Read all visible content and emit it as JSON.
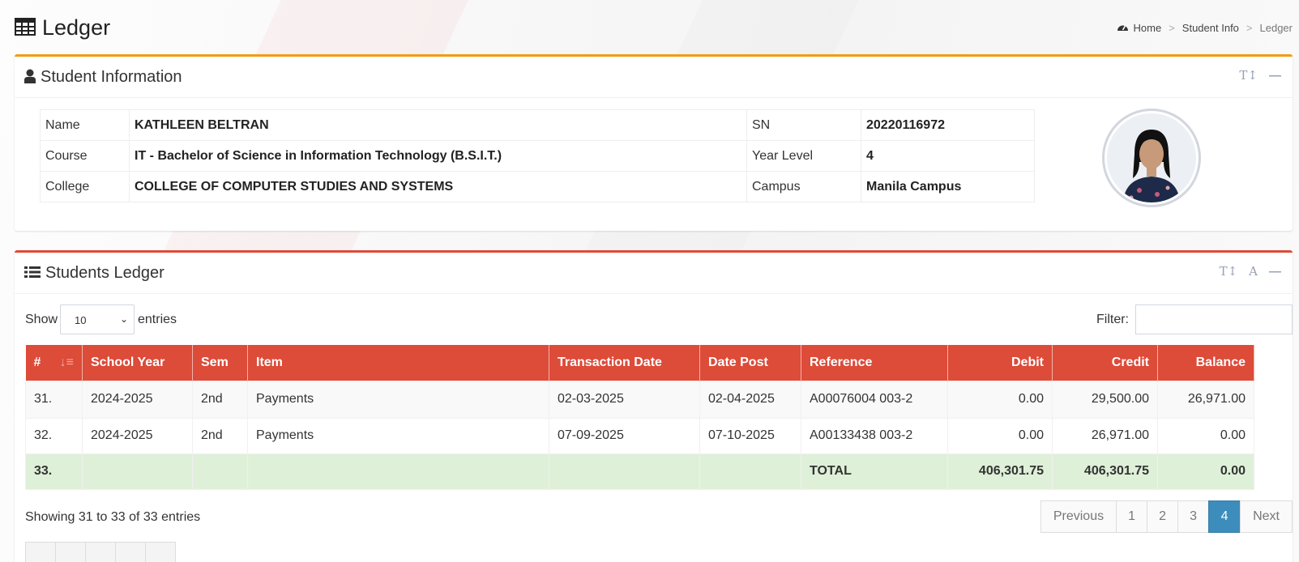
{
  "header": {
    "title": "Ledger",
    "icon": "table-icon"
  },
  "breadcrumb": [
    {
      "label": "Home",
      "icon": "dashboard-icon"
    },
    {
      "label": "Student Info"
    },
    {
      "label": "Ledger"
    }
  ],
  "student_info": {
    "title": "Student Information",
    "rows": [
      {
        "l1": "Name",
        "v1": "KATHLEEN BELTRAN",
        "l2": "SN",
        "v2": "20220116972"
      },
      {
        "l1": "Course",
        "v1": "IT - Bachelor of Science in Information Technology (B.S.I.T.)",
        "l2": "Year Level",
        "v2": "4"
      },
      {
        "l1": "College",
        "v1": "COLLEGE OF COMPUTER STUDIES AND SYSTEMS",
        "l2": "Campus",
        "v2": "Manila Campus"
      }
    ]
  },
  "ledger": {
    "title": "Students Ledger",
    "show_label": "Show",
    "entries_value": "10",
    "entries_label": "entries",
    "filter_label": "Filter:",
    "filter_value": "",
    "columns": [
      "#",
      "School Year",
      "Sem",
      "Item",
      "Transaction Date",
      "Date Post",
      "Reference",
      "Debit",
      "Credit",
      "Balance"
    ],
    "rows": [
      {
        "no": "31.",
        "sy": "2024-2025",
        "sem": "2nd",
        "item": "Payments",
        "tdate": "02-03-2025",
        "dpost": "02-04-2025",
        "ref": "A00076004 003-2",
        "debit": "0.00",
        "credit": "29,500.00",
        "balance": "26,971.00"
      },
      {
        "no": "32.",
        "sy": "2024-2025",
        "sem": "2nd",
        "item": "Payments",
        "tdate": "07-09-2025",
        "dpost": "07-10-2025",
        "ref": "A00133438 003-2",
        "debit": "0.00",
        "credit": "26,971.00",
        "balance": "0.00"
      }
    ],
    "total": {
      "no": "33.",
      "label": "TOTAL",
      "debit": "406,301.75",
      "credit": "406,301.75",
      "balance": "0.00"
    },
    "showing": "Showing 31 to 33 of 33 entries",
    "pagination": {
      "prev": "Previous",
      "pages": [
        "1",
        "2",
        "3",
        "4"
      ],
      "active": "4",
      "next": "Next"
    }
  },
  "colors": {
    "info_accent": "#f39c12",
    "ledger_accent": "#dd4b39",
    "total_row": "#dff0d8",
    "active_page": "#3c8dbc"
  }
}
